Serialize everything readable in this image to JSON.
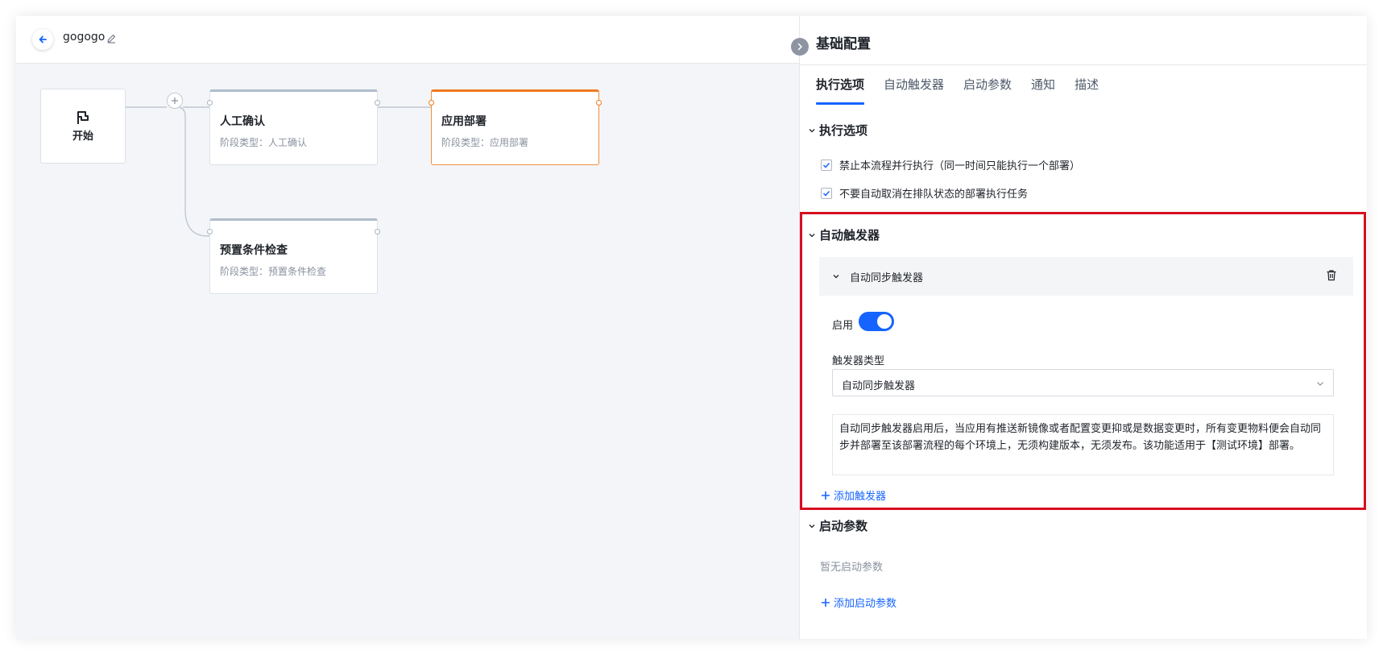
{
  "header": {
    "title": "gogogo"
  },
  "canvas": {
    "start_label": "开始",
    "stages": [
      {
        "name": "人工确认",
        "type": "阶段类型：人工确认"
      },
      {
        "name": "应用部署",
        "type": "阶段类型：应用部署"
      },
      {
        "name": "预置条件检查",
        "type": "阶段类型：预置条件检查"
      }
    ]
  },
  "panel": {
    "title": "基础配置",
    "tabs": [
      "执行选项",
      "自动触发器",
      "启动参数",
      "通知",
      "描述"
    ],
    "active_tab": "执行选项",
    "exec_options": {
      "title": "执行选项",
      "checks": [
        {
          "label": "禁止本流程并行执行（同一时间只能执行一个部署）",
          "checked": true
        },
        {
          "label": "不要自动取消在排队状态的部署执行任务",
          "checked": true
        }
      ]
    },
    "auto_trigger": {
      "title": "自动触发器",
      "card_title": "自动同步触发器",
      "enable_label": "启用",
      "enabled": true,
      "type_label": "触发器类型",
      "type_value": "自动同步触发器",
      "description": "自动同步触发器启用后，当应用有推送新镜像或者配置变更抑或是数据变更时，所有变更物料便会自动同步并部署至该部署流程的每个环境上，无须构建版本，无须发布。该功能适用于【测试环境】部署。",
      "add_label": "添加触发器"
    },
    "launch_params": {
      "title": "启动参数",
      "empty_text": "暂无启动参数",
      "add_label": "添加启动参数"
    }
  },
  "colors": {
    "primary": "#1664ff",
    "active_stage": "#f07a1e",
    "highlight_box": "#d50f1f"
  }
}
